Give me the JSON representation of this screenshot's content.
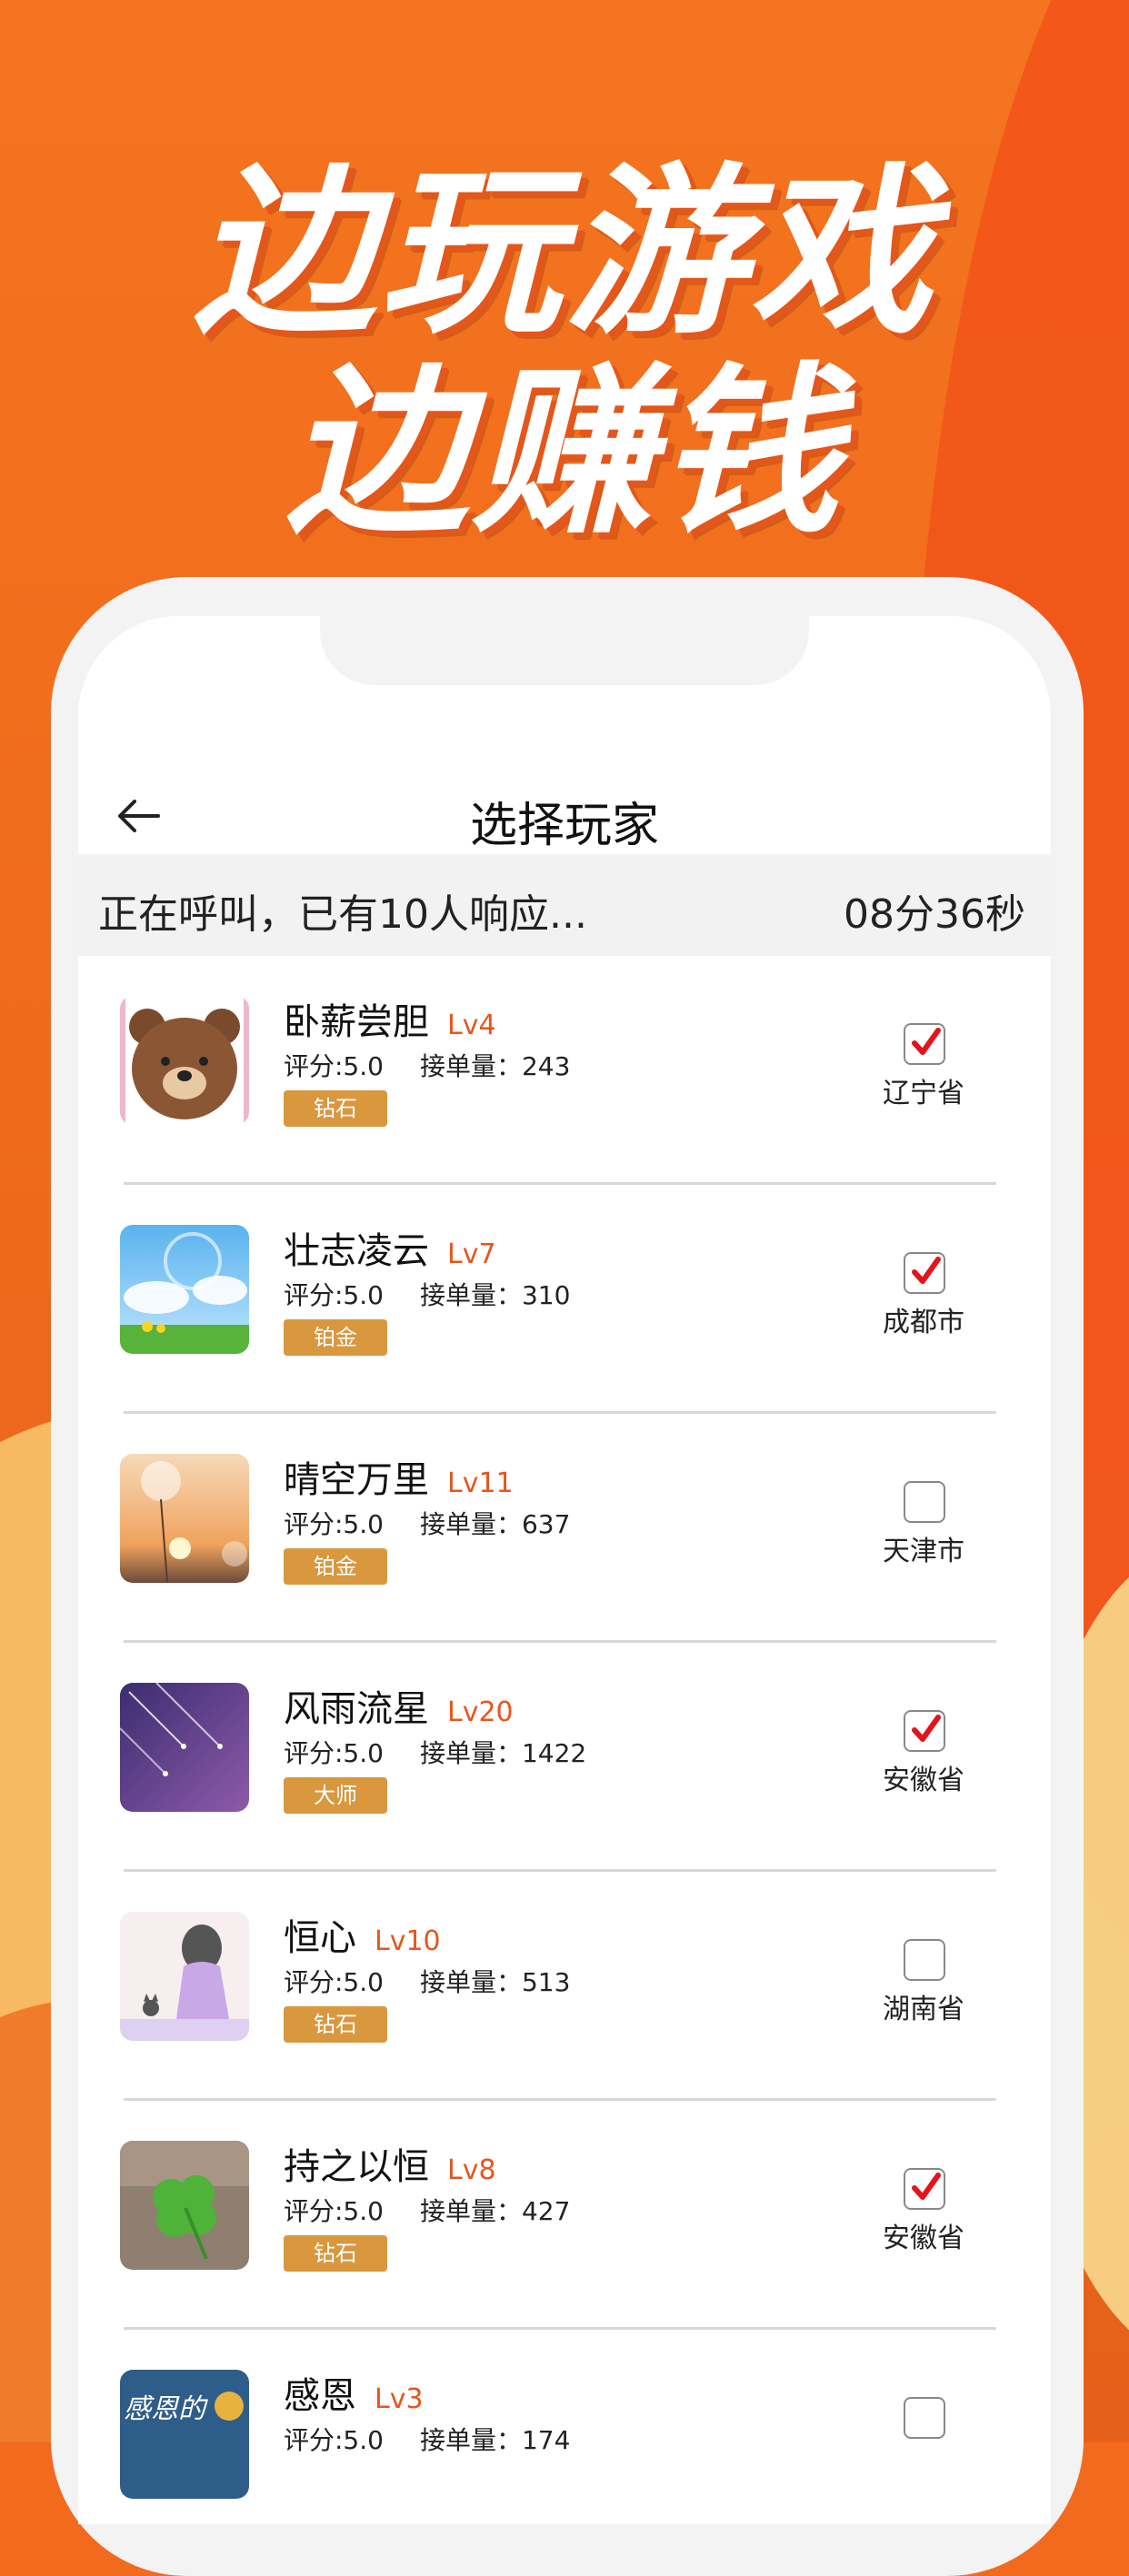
{
  "headline": {
    "line1": "边玩游戏",
    "line2": "边赚钱"
  },
  "nav": {
    "title": "选择玩家"
  },
  "call": {
    "status": "正在呼叫，已有10人响应...",
    "timer": "08分36秒"
  },
  "labels": {
    "rating_prefix": "评分:",
    "orders_prefix": "接单量："
  },
  "players": [
    {
      "name": "卧薪尝胆",
      "level": "Lv4",
      "rating": "5.0",
      "orders": "243",
      "badge": "钻石",
      "checked": true,
      "location": "辽宁省",
      "avatar": "bear"
    },
    {
      "name": "壮志凌云",
      "level": "Lv7",
      "rating": "5.0",
      "orders": "310",
      "badge": "铂金",
      "checked": true,
      "location": "成都市",
      "avatar": "sky"
    },
    {
      "name": "晴空万里",
      "level": "Lv11",
      "rating": "5.0",
      "orders": "637",
      "badge": "铂金",
      "checked": false,
      "location": "天津市",
      "avatar": "dandelion"
    },
    {
      "name": "风雨流星",
      "level": "Lv20",
      "rating": "5.0",
      "orders": "1422",
      "badge": "大师",
      "checked": true,
      "location": "安徽省",
      "avatar": "meteor"
    },
    {
      "name": "恒心",
      "level": "Lv10",
      "rating": "5.0",
      "orders": "513",
      "badge": "钻石",
      "checked": false,
      "location": "湖南省",
      "avatar": "girl-cat"
    },
    {
      "name": "持之以恒",
      "level": "Lv8",
      "rating": "5.0",
      "orders": "427",
      "badge": "钻石",
      "checked": true,
      "location": "安徽省",
      "avatar": "clover"
    },
    {
      "name": "感恩",
      "level": "Lv3",
      "rating": "5.0",
      "orders": "174",
      "badge": "",
      "checked": false,
      "location": "",
      "avatar": "gratitude"
    }
  ],
  "avatar_text": {
    "gratitude": "感恩的"
  }
}
